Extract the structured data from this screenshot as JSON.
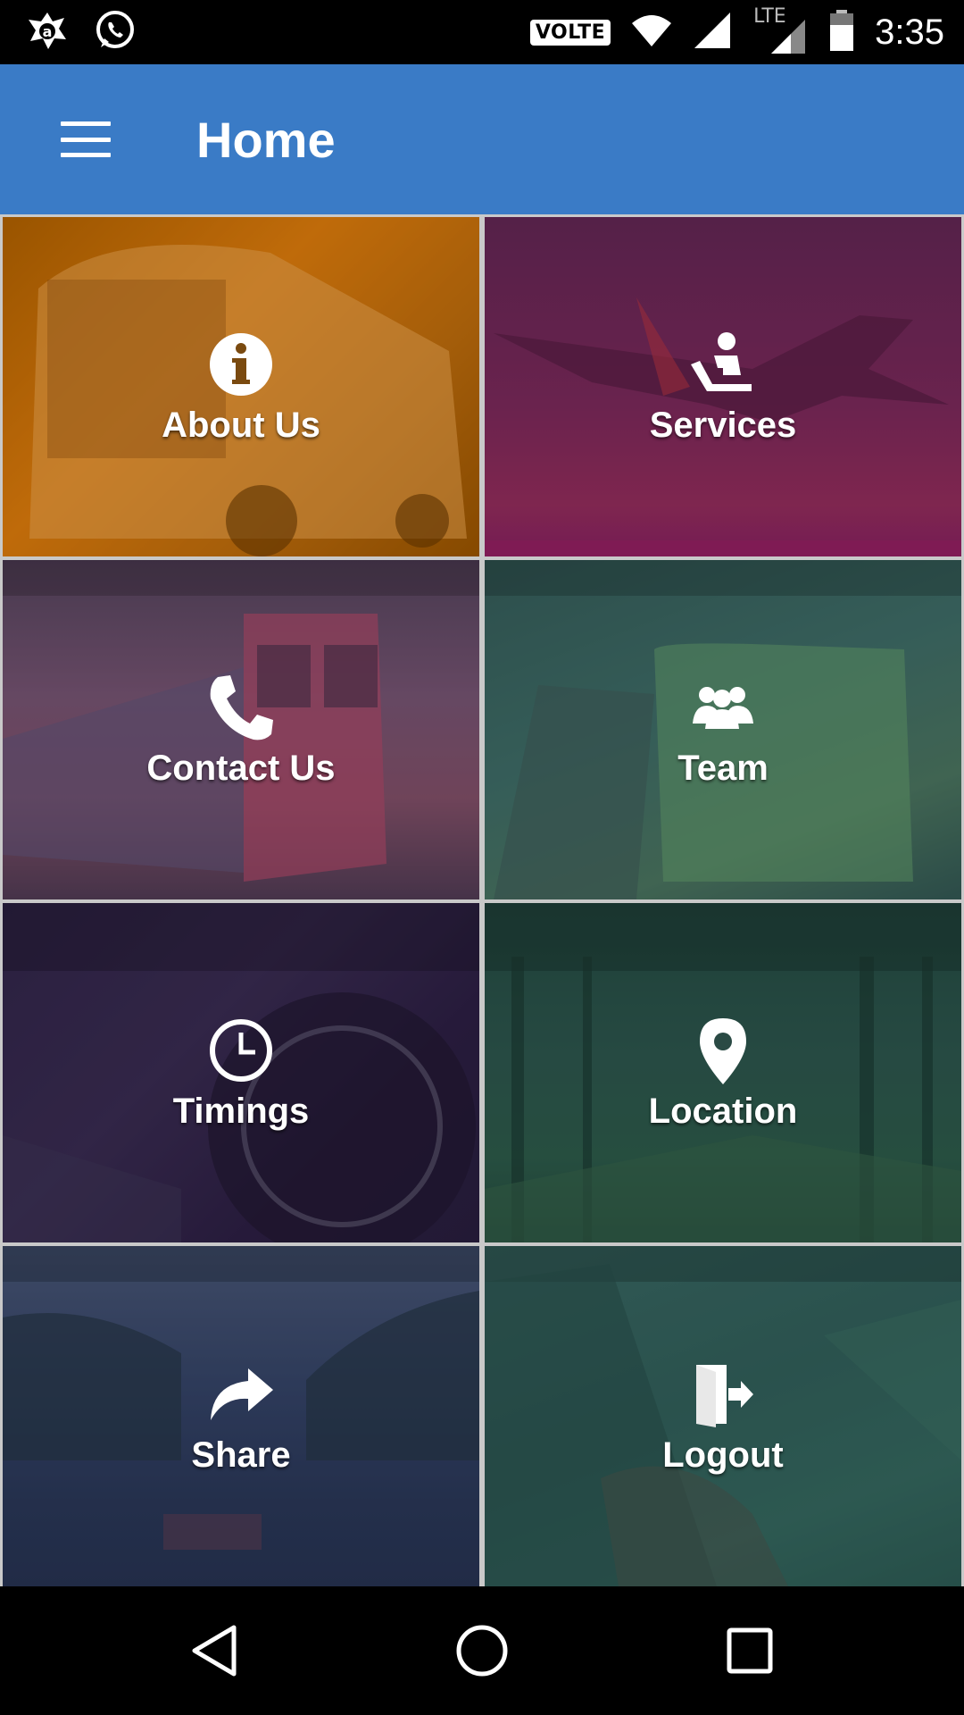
{
  "status_bar": {
    "time": "3:35",
    "volte_label": "VOLTE",
    "network_label": "LTE",
    "icons": [
      "app-notification-icon",
      "whatsapp-icon",
      "wifi-icon",
      "signal-icon",
      "battery-icon"
    ]
  },
  "app_bar": {
    "title": "Home",
    "menu_icon": "hamburger-menu-icon",
    "color": "#3a7bc6"
  },
  "tiles": [
    {
      "label": "About Us",
      "icon": "info-icon",
      "tint": "#b86400"
    },
    {
      "label": "Services",
      "icon": "service-desk-icon",
      "tint": "#6a1f4a"
    },
    {
      "label": "Contact Us",
      "icon": "phone-icon",
      "tint": "#5b3a58"
    },
    {
      "label": "Team",
      "icon": "team-icon",
      "tint": "#2f5a55"
    },
    {
      "label": "Timings",
      "icon": "clock-icon",
      "tint": "#2a1c40"
    },
    {
      "label": "Location",
      "icon": "location-pin-icon",
      "tint": "#1f4a40"
    },
    {
      "label": "Share",
      "icon": "share-arrow-icon",
      "tint": "#283654"
    },
    {
      "label": "Logout",
      "icon": "logout-icon",
      "tint": "#2a5550"
    }
  ],
  "nav_bar": {
    "icons": [
      "back-icon",
      "home-icon",
      "recents-icon"
    ]
  }
}
